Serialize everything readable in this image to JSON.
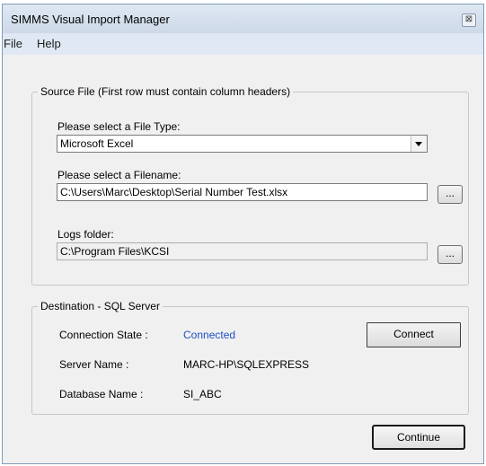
{
  "window": {
    "title": "SIMMS Visual Import Manager",
    "close_glyph": "⊠"
  },
  "menu": {
    "items": [
      "File",
      "Help"
    ]
  },
  "source": {
    "legend": "Source File  (First row must contain column headers)",
    "file_type_label": "Please select a File Type:",
    "file_type_value": "Microsoft Excel",
    "filename_label": "Please select a Filename:",
    "filename_value": "C:\\Users\\Marc\\Desktop\\Serial Number Test.xlsx",
    "browse_label": "...",
    "logs_label": "Logs folder:",
    "logs_value": "C:\\Program Files\\KCSI",
    "logs_browse_label": "..."
  },
  "destination": {
    "legend": "Destination - SQL Server",
    "connection_state_label": "Connection State :",
    "connection_state_value": "Connected",
    "server_name_label": "Server Name :",
    "server_name_value": "MARC-HP\\SQLEXPRESS",
    "database_name_label": "Database Name :",
    "database_name_value": "SI_ABC",
    "connect_label": "Connect"
  },
  "footer": {
    "continue_label": "Continue"
  },
  "colors": {
    "status_connected": "#1f4fc6",
    "titlebar": "#dfe8f3"
  }
}
